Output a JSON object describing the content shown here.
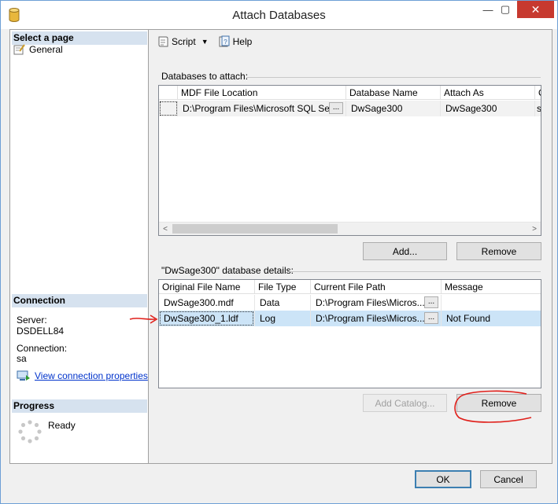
{
  "window": {
    "title": "Attach Databases",
    "close_glyph": "✕",
    "minimize_glyph": "—",
    "maximize_glyph": "▢"
  },
  "left_pane": {
    "select_page_header": "Select a page",
    "nav_items": [
      {
        "label": "General",
        "icon": "general-page-icon"
      }
    ],
    "connection_header": "Connection",
    "server_label": "Server:",
    "server_value": "DSDELL84",
    "connection_label": "Connection:",
    "connection_value": "sa",
    "view_connection_link": "View connection properties",
    "progress_header": "Progress",
    "progress_status": "Ready"
  },
  "toolbar": {
    "script_label": "Script",
    "help_label": "Help"
  },
  "databases_to_attach": {
    "label": "Databases to attach:",
    "columns": [
      "MDF File Location",
      "Database Name",
      "Attach As",
      "O"
    ],
    "rows": [
      {
        "mdf_location": "D:\\Program Files\\Microsoft SQL Se...",
        "browse": "...",
        "database_name": "DwSage300",
        "attach_as": "DwSage300",
        "owner": "s"
      }
    ],
    "add_button": "Add...",
    "remove_button": "Remove"
  },
  "database_details": {
    "label": "\"DwSage300\" database details:",
    "columns": [
      "Original File Name",
      "File Type",
      "Current File Path",
      "Message"
    ],
    "rows": [
      {
        "original_file": "DwSage300.mdf",
        "file_type": "Data",
        "current_path": "D:\\Program Files\\Micros...",
        "browse": "...",
        "message": ""
      },
      {
        "original_file": "DwSage300_1.ldf",
        "file_type": "Log",
        "current_path": "D:\\Program Files\\Micros...",
        "browse": "...",
        "message": "Not Found"
      }
    ],
    "add_catalog_button": "Add Catalog...",
    "remove_button": "Remove"
  },
  "footer": {
    "ok_button": "OK",
    "cancel_button": "Cancel"
  },
  "colors": {
    "selection": "#cce4f7",
    "annotation": "#e0201b",
    "link": "#0033cc",
    "close": "#c7392f"
  }
}
